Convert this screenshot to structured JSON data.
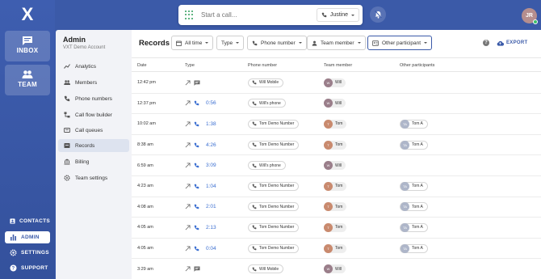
{
  "rail": {
    "logo": "X",
    "inbox_label": "INBOX",
    "team_label": "TEAM",
    "contacts_label": "CONTACTS",
    "admin_label": "ADMIN",
    "settings_label": "SETTINGS",
    "support_label": "SUPPORT"
  },
  "topbar": {
    "call_placeholder": "Start a call...",
    "caller": "Justine",
    "user_initials": "JR"
  },
  "admin": {
    "title": "Admin",
    "subtitle": "VXT Demo Account",
    "nav": [
      {
        "label": "Analytics",
        "icon": "chart-line-icon"
      },
      {
        "label": "Members",
        "icon": "people-icon"
      },
      {
        "label": "Phone numbers",
        "icon": "phone-icon"
      },
      {
        "label": "Call flow builder",
        "icon": "flow-icon"
      },
      {
        "label": "Call queues",
        "icon": "queue-icon"
      },
      {
        "label": "Records",
        "icon": "records-icon",
        "active": true
      },
      {
        "label": "Billing",
        "icon": "bank-icon"
      },
      {
        "label": "Team settings",
        "icon": "gear-icon"
      }
    ]
  },
  "records": {
    "title": "Records",
    "filters": {
      "time": "All time",
      "type": "Type",
      "phone": "Phone number",
      "member": "Team member",
      "other": "Other participant"
    },
    "export_label": "EXPORT",
    "columns": {
      "date": "Date",
      "type": "Type",
      "phone": "Phone number",
      "member": "Team member",
      "other": "Other participants"
    },
    "rows": [
      {
        "date": "12:42 pm",
        "kind": "message",
        "duration": "",
        "phone": "Will Mobile",
        "member": "Will",
        "member_initials": "W",
        "member_color": "#9a7e8a",
        "other": "",
        "other_initials": ""
      },
      {
        "date": "12:37 pm",
        "kind": "call",
        "duration": "0:56",
        "phone": "Will's phone",
        "member": "Will",
        "member_initials": "W",
        "member_color": "#9a7e8a",
        "other": "",
        "other_initials": ""
      },
      {
        "date": "10:02 am",
        "kind": "call",
        "duration": "1:38",
        "phone": "Tom Demo Number",
        "member": "Tom",
        "member_initials": "T",
        "member_color": "#c98a6e",
        "other": "Tom A",
        "other_initials": "TA"
      },
      {
        "date": "8:38 am",
        "kind": "call",
        "duration": "4:26",
        "phone": "Tom Demo Number",
        "member": "Tom",
        "member_initials": "T",
        "member_color": "#c98a6e",
        "other": "Tom A",
        "other_initials": "TA"
      },
      {
        "date": "6:59 am",
        "kind": "call",
        "duration": "3:09",
        "phone": "Will's phone",
        "member": "Will",
        "member_initials": "W",
        "member_color": "#9a7e8a",
        "other": "",
        "other_initials": ""
      },
      {
        "date": "4:23 am",
        "kind": "call",
        "duration": "1:04",
        "phone": "Tom Demo Number",
        "member": "Tom",
        "member_initials": "T",
        "member_color": "#c98a6e",
        "other": "Tom A",
        "other_initials": "TA"
      },
      {
        "date": "4:08 am",
        "kind": "call",
        "duration": "2:01",
        "phone": "Tom Demo Number",
        "member": "Tom",
        "member_initials": "T",
        "member_color": "#c98a6e",
        "other": "Tom A",
        "other_initials": "TA"
      },
      {
        "date": "4:05 am",
        "kind": "call",
        "duration": "2:13",
        "phone": "Tom Demo Number",
        "member": "Tom",
        "member_initials": "T",
        "member_color": "#c98a6e",
        "other": "Tom A",
        "other_initials": "TA"
      },
      {
        "date": "4:05 am",
        "kind": "call",
        "duration": "0:04",
        "phone": "Tom Demo Number",
        "member": "Tom",
        "member_initials": "T",
        "member_color": "#c98a6e",
        "other": "Tom A",
        "other_initials": "TA"
      },
      {
        "date": "3:29 am",
        "kind": "message",
        "duration": "",
        "phone": "Will Mobile",
        "member": "Will",
        "member_initials": "W",
        "member_color": "#9a7e8a",
        "other": "",
        "other_initials": ""
      }
    ]
  },
  "colors": {
    "brand": "#3b5aa8",
    "link": "#3b6fd1",
    "status_online": "#3bbf6a",
    "dialpad": "#2e9e5a"
  }
}
